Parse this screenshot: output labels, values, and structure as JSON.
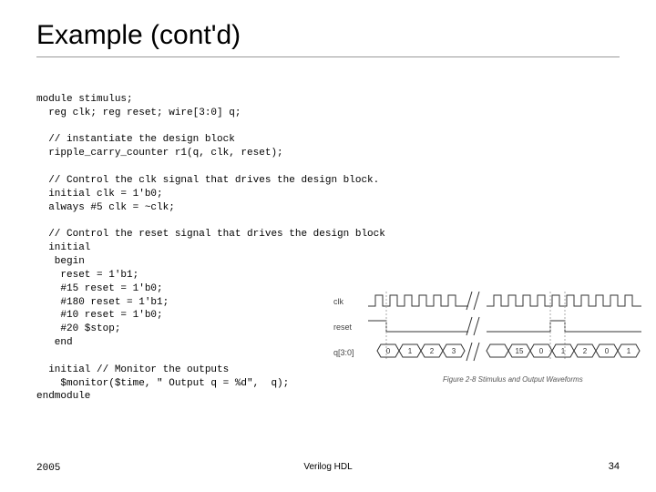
{
  "slide": {
    "title": "Example (cont'd)"
  },
  "code": {
    "l1": "module stimulus;",
    "l2": "  reg clk; reg reset; wire[3:0] q;",
    "l3": "",
    "l4": "  // instantiate the design block",
    "l5": "  ripple_carry_counter r1(q, clk, reset);",
    "l6": "",
    "l7": "  // Control the clk signal that drives the design block.",
    "l8": "  initial clk = 1'b0;",
    "l9": "  always #5 clk = ~clk;",
    "l10": "",
    "l11": "  // Control the reset signal that drives the design block",
    "l12": "  initial",
    "l13": "   begin",
    "l14": "    reset = 1'b1;",
    "l15": "    #15 reset = 1'b0;",
    "l16": "    #180 reset = 1'b1;",
    "l17": "    #10 reset = 1'b0;",
    "l18": "    #20 $stop;",
    "l19": "   end",
    "l20": "",
    "l21": "  initial // Monitor the outputs",
    "l22": "    $monitor($time, \" Output q = %d\",  q);",
    "l23": "endmodule"
  },
  "waveform": {
    "labels": {
      "clk": "clk",
      "reset": "reset",
      "q": "q[3:0]"
    },
    "q_values": [
      "0",
      "1",
      "2",
      "3",
      "",
      "15",
      "0",
      "1",
      "2",
      "0",
      "1"
    ],
    "caption": "Figure 2-8  Stimulus and Output Waveforms"
  },
  "footer": {
    "year": "2005",
    "center": "Verilog HDL",
    "page": "34"
  }
}
